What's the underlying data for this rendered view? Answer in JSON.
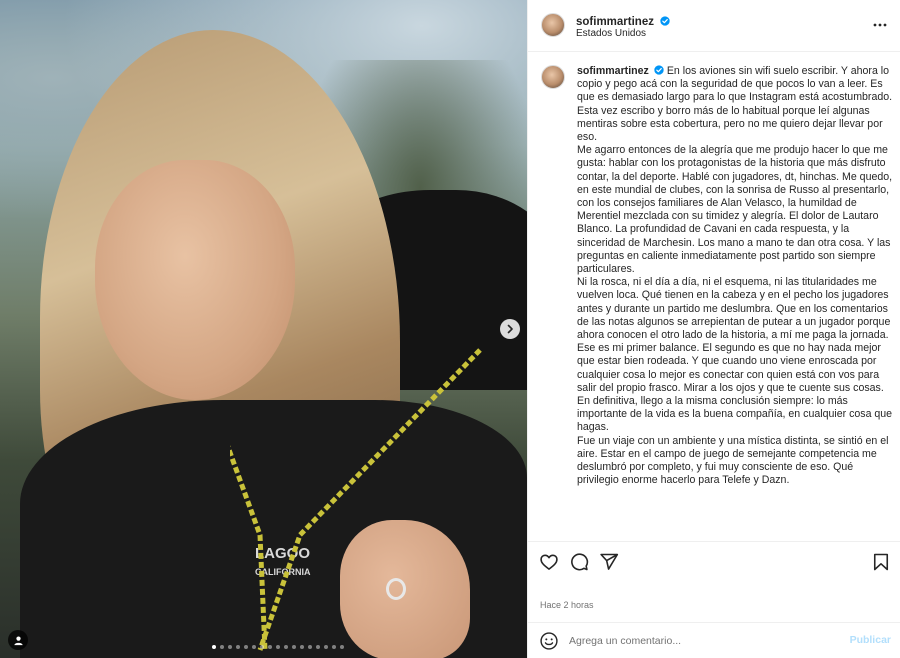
{
  "carousel": {
    "shirt_print_lines": [
      "LAGOO",
      "CALIFORNIA"
    ],
    "total_slides": 17,
    "active_slide": 1
  },
  "header": {
    "username": "sofimmartinez",
    "location": "Estados Unidos"
  },
  "caption": {
    "username": "sofimmartinez",
    "paragraphs": [
      "En los aviones sin wifi suelo escribir. Y ahora lo copio y pego acá con la seguridad de que pocos lo van a leer. Es que es demasiado largo para lo que Instagram está acostumbrado.",
      "Esta vez escribo y borro más de lo habitual porque leí algunas mentiras sobre esta cobertura, pero no me quiero dejar llevar por eso.",
      "Me agarro entonces de la alegría que me produjo hacer lo que me gusta: hablar con los protagonistas de la historia que más disfruto contar, la del deporte. Hablé con jugadores, dt, hinchas. Me quedo, en este mundial de clubes, con la sonrisa de Russo al presentarlo, con los consejos familiares de Alan Velasco, la humildad de Merentiel mezclada con su timidez y alegría. El dolor de Lautaro Blanco. La profundidad de Cavani en cada respuesta, y la sinceridad de Marchesin. Los mano a mano te dan otra cosa. Y las preguntas en caliente inmediatamente post partido son siempre particulares.",
      "Ni la rosca, ni el día a día, ni el esquema, ni las titularidades me vuelven loca. Qué tienen en la cabeza y en el pecho los jugadores antes y durante un partido me deslumbra. Que en los comentarios de las notas algunos se arrepientan de putear a un jugador porque ahora conocen el otro lado de la historia, a mí me paga la jornada.",
      "Ese es mi primer balance. El segundo es que no hay nada mejor que estar bien rodeada. Y que cuando uno viene enroscada por cualquier cosa lo mejor es conectar con quien está con vos para salir del propio frasco. Mirar a los ojos y que te cuente sus cosas. En definitiva, llego a la misma conclusión siempre: lo más importante de la vida es la buena compañía, en cualquier cosa que hagas.",
      "Fue un viaje con un ambiente y una mística distinta, se sintió en el aire. Estar en el campo de juego de semejante competencia me deslumbró por completo, y fui muy consciente de eso. Qué privilegio enorme hacerlo para Telefe y Dazn."
    ]
  },
  "meta": {
    "timestamp": "Hace 2 horas"
  },
  "comment_box": {
    "placeholder": "Agrega un comentario...",
    "post_label": "Publicar"
  },
  "colors": {
    "verified_blue": "#0095f6",
    "post_button_disabled": "#b2dffc"
  }
}
